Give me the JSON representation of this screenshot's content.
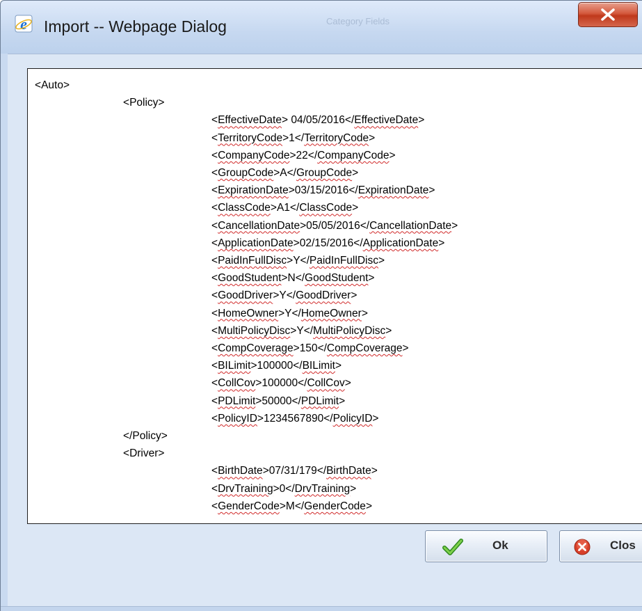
{
  "window": {
    "title": "Import -- Webpage Dialog",
    "background_title_ghost": "Category Fields"
  },
  "icons": {
    "app_icon": "ie-icon",
    "close_icon": "close-icon",
    "ok_icon": "checkmark-icon",
    "cancel_icon": "cancel-icon"
  },
  "colors": {
    "close_button": "#c9411f",
    "spellcheck_underline": "#d12a2a",
    "dialog_background": "#dce7f5"
  },
  "xml_lines": [
    {
      "indent": 0,
      "open": "Auto",
      "value": null,
      "close": null
    },
    {
      "indent": 1,
      "open": "Policy",
      "value": null,
      "close": null
    },
    {
      "indent": 2,
      "open": "EffectiveDate",
      "value": " 04/05/2016",
      "close": "EffectiveDate"
    },
    {
      "indent": 2,
      "open": "TerritoryCode",
      "value": "1",
      "close": "TerritoryCode"
    },
    {
      "indent": 2,
      "open": "CompanyCode",
      "value": "22",
      "close": "CompanyCode"
    },
    {
      "indent": 2,
      "open": "GroupCode",
      "value": "A",
      "close": "GroupCode"
    },
    {
      "indent": 2,
      "open": "ExpirationDate",
      "value": "03/15/2016",
      "close": "ExpirationDate"
    },
    {
      "indent": 2,
      "open": "ClassCode",
      "value": "A1",
      "close": "ClassCode"
    },
    {
      "indent": 2,
      "open": "CancellationDate",
      "value": "05/05/2016",
      "close": "CancellationDate"
    },
    {
      "indent": 2,
      "open": "ApplicationDate",
      "value": "02/15/2016",
      "close": "ApplicationDate"
    },
    {
      "indent": 2,
      "open": "PaidInFullDisc",
      "value": "Y",
      "close": "PaidInFullDisc"
    },
    {
      "indent": 2,
      "open": "GoodStudent",
      "value": "N",
      "close": "GoodStudent"
    },
    {
      "indent": 2,
      "open": "GoodDriver",
      "value": "Y",
      "close": "GoodDriver"
    },
    {
      "indent": 2,
      "open": "HomeOwner",
      "value": "Y",
      "close": "HomeOwner"
    },
    {
      "indent": 2,
      "open": "MultiPolicyDisc",
      "value": "Y",
      "close": "MultiPolicyDisc"
    },
    {
      "indent": 2,
      "open": "CompCoverage",
      "value": "150",
      "close": "CompCoverage"
    },
    {
      "indent": 2,
      "open": "BILimit",
      "value": "100000",
      "close": "BILimit"
    },
    {
      "indent": 2,
      "open": "CollCov",
      "value": "100000",
      "close": "CollCov"
    },
    {
      "indent": 2,
      "open": "PDLimit",
      "value": "50000",
      "close": "PDLimit"
    },
    {
      "indent": 2,
      "open": "PolicyID",
      "value": "1234567890",
      "close": "PolicyID"
    },
    {
      "indent": 1,
      "open": null,
      "value": null,
      "close": "Policy"
    },
    {
      "indent": 1,
      "open": "Driver",
      "value": null,
      "close": null
    },
    {
      "indent": 2,
      "open": "BirthDate",
      "value": "07/31/179",
      "close": "BirthDate"
    },
    {
      "indent": 2,
      "open": "DrvTraining",
      "value": "0",
      "close": "DrvTraining"
    },
    {
      "indent": 2,
      "open": "GenderCode",
      "value": "M",
      "close": "GenderCode"
    }
  ],
  "buttons": {
    "ok_label": "Ok",
    "close_label": "Clos"
  }
}
